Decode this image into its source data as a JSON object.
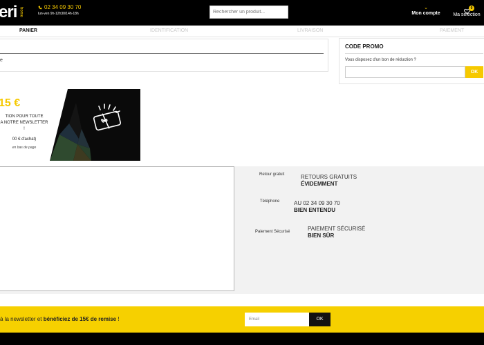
{
  "header": {
    "logo_text": "eri",
    "logo_sub": "home",
    "phone": "02 34 09 30 70",
    "hours": "lun-ven 9h-12h30/14h-18h",
    "search_placeholder": "Rechercher un produit...",
    "account_label": "Mon compte",
    "selection_label": "Ma sélection",
    "selection_count": "0"
  },
  "steps": [
    "PANIER",
    "IDENTIFICATION",
    "LIVRAISON",
    "PAIEMENT"
  ],
  "cart": {
    "text": "e"
  },
  "promo": {
    "title": "CODE PROMO",
    "question": "Vous disposez d'un bon de réduction ?",
    "ok_label": "OK"
  },
  "banner": {
    "amount": "15 €",
    "line1": "TION POUR TOUTE",
    "line2": "A NOTRE NEWSLETTER",
    "line3": "!",
    "condition": "00 € d'achat)",
    "note": "en bas de page"
  },
  "reassurance": [
    {
      "label": "Retour gratuit",
      "title": "RETOURS GRATUITS",
      "strong": "ÉVIDEMMENT"
    },
    {
      "label": "Téléphone",
      "title": "AU 02 34 09 30 70",
      "strong": "BIEN ENTENDU"
    },
    {
      "label": "Paiement Sécurisé",
      "title": "PAIEMENT SÉCURISÉ",
      "strong": "BIEN SÛR"
    }
  ],
  "newsletter": {
    "text_start": "à la newsletter et ",
    "text_bold": "bénéficiez de 15€ de remise",
    "text_end": " !",
    "email_placeholder": "Email",
    "ok_label": "OK"
  },
  "colors": {
    "accent": "#f6c900",
    "dark": "#000000",
    "newsletter_bg": "#f6d000"
  }
}
